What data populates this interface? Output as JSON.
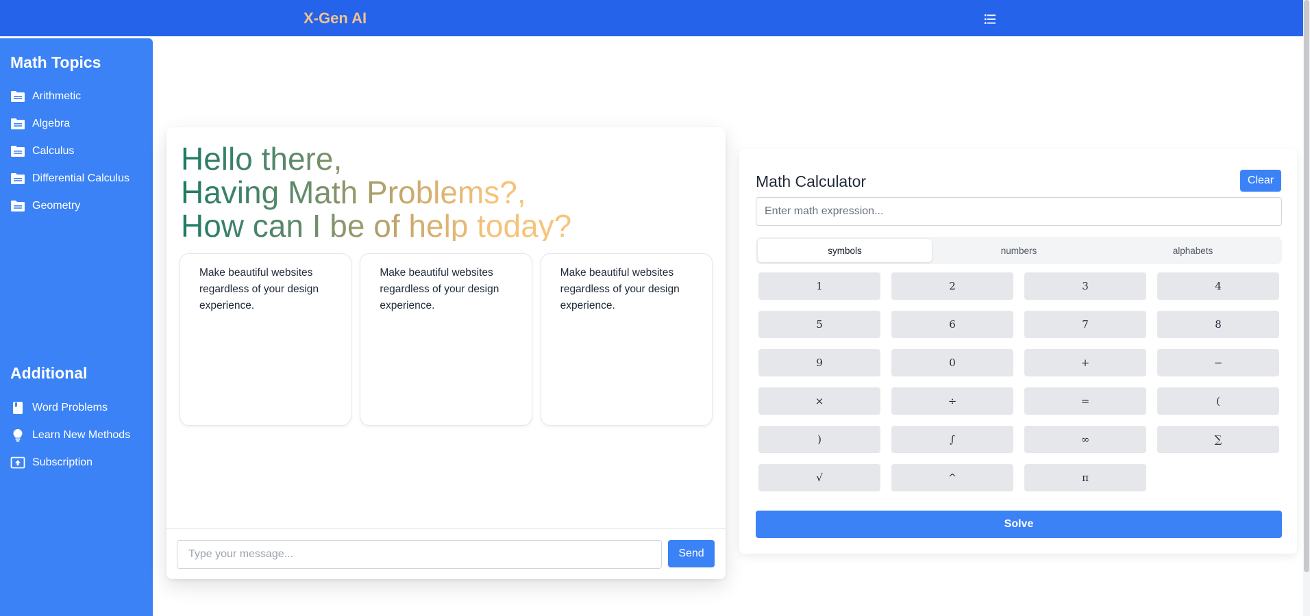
{
  "header": {
    "brand": "X-Gen AI",
    "menu_icon": "list-icon"
  },
  "sidebar": {
    "topics_heading": "Math Topics",
    "topics": [
      {
        "label": "Arithmetic",
        "icon": "folder-icon"
      },
      {
        "label": "Algebra",
        "icon": "folder-icon"
      },
      {
        "label": "Calculus",
        "icon": "folder-icon"
      },
      {
        "label": "Differential Calculus",
        "icon": "folder-icon"
      },
      {
        "label": "Geometry",
        "icon": "folder-icon"
      }
    ],
    "additional_heading": "Additional",
    "additional": [
      {
        "label": "Word Problems",
        "icon": "book-icon"
      },
      {
        "label": "Learn New Methods",
        "icon": "lightbulb-icon"
      },
      {
        "label": "Subscription",
        "icon": "upload-box-icon"
      }
    ]
  },
  "chat": {
    "greeting": [
      "Hello there,",
      "Having Math Problems?,",
      "How can I be of help today?"
    ],
    "cards": [
      {
        "text": "Make beautiful websites regardless of your design experience."
      },
      {
        "text": "Make beautiful websites regardless of your design experience."
      },
      {
        "text": "Make beautiful websites regardless of your design experience."
      }
    ],
    "input_placeholder": "Type your message...",
    "input_value": "",
    "send_label": "Send"
  },
  "calculator": {
    "title": "Math Calculator",
    "clear_label": "Clear",
    "input_placeholder": "Enter math expression...",
    "input_value": "",
    "tabs": [
      {
        "label": "symbols",
        "active": true
      },
      {
        "label": "numbers",
        "active": false
      },
      {
        "label": "alphabets",
        "active": false
      }
    ],
    "keys": [
      "1",
      "2",
      "3",
      "4",
      "5",
      "6",
      "7",
      "8",
      "9",
      "0",
      "+",
      "−",
      "×",
      "÷",
      "=",
      "(",
      ")",
      "∫",
      "∞",
      "∑",
      "√",
      "^",
      "π"
    ],
    "solve_label": "Solve"
  },
  "colors": {
    "topbar": "#2563eb",
    "sidebar": "#3b82f6",
    "brand_text": "#f1c28e",
    "accent_button": "#3b82f6",
    "key_bg": "#e5e7eb"
  }
}
